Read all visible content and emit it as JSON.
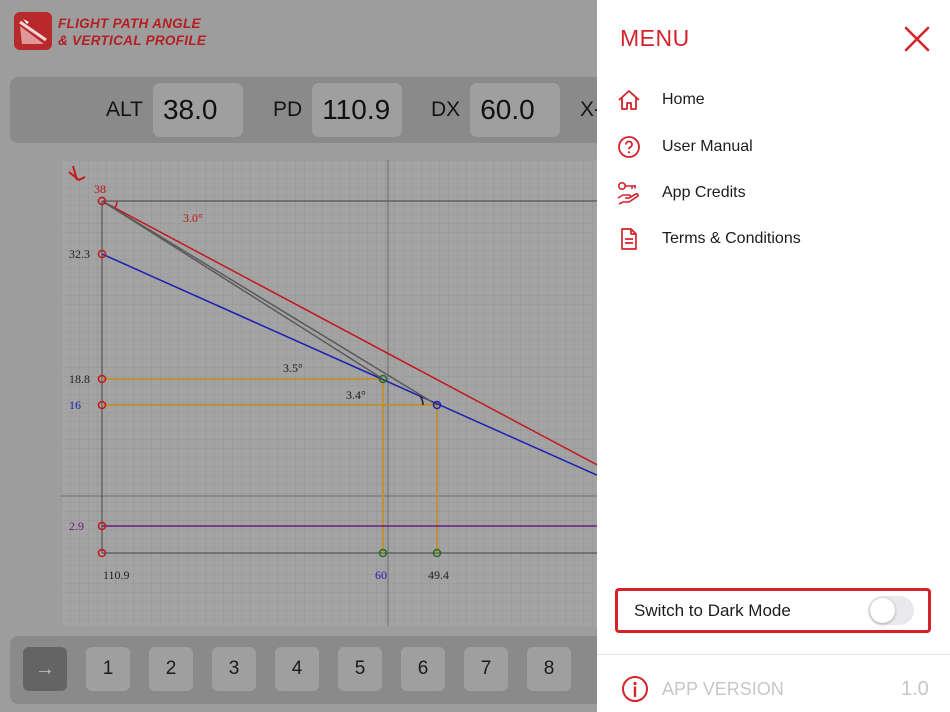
{
  "app": {
    "title_line1": "FLIGHT PATH ANGLE",
    "title_line2": "& VERTICAL PROFILE"
  },
  "params": [
    {
      "label": "ALT",
      "value": "38.0"
    },
    {
      "label": "PD",
      "value": "110.9"
    },
    {
      "label": "DX",
      "value": "60.0"
    },
    {
      "label": "X-",
      "value": ""
    }
  ],
  "graph": {
    "labels": {
      "alt_top": "38",
      "angle_red": "3.0°",
      "alt_blue_start": "32.3",
      "angle_gray1": "3.5°",
      "alt_gray": "18.8",
      "angle_gray2": "3.4°",
      "alt_blue": "16",
      "alt_purple": "2.9",
      "dist_total": "110.9",
      "dist_dx": "60",
      "dist_point": "49.4"
    },
    "colors": {
      "red": "#c3161c",
      "blue": "#1c1fb0",
      "orange": "#c98a14",
      "purple": "#6b1e7a",
      "gray": "#5a5a5a"
    }
  },
  "buttons": {
    "arrow": "→",
    "numbers": [
      "1",
      "2",
      "3",
      "4",
      "5",
      "6",
      "7",
      "8"
    ]
  },
  "menu": {
    "title": "MENU",
    "items": [
      {
        "label": "Home",
        "icon": "home-icon"
      },
      {
        "label": "User Manual",
        "icon": "question-circle-icon"
      },
      {
        "label": "App Credits",
        "icon": "hand-key-icon"
      },
      {
        "label": "Terms & Conditions",
        "icon": "document-icon"
      }
    ],
    "dark_mode_label": "Switch to Dark Mode",
    "dark_mode_on": false,
    "version_label": "APP VERSION",
    "version_value": "1.0",
    "accent": "#d4232a"
  }
}
